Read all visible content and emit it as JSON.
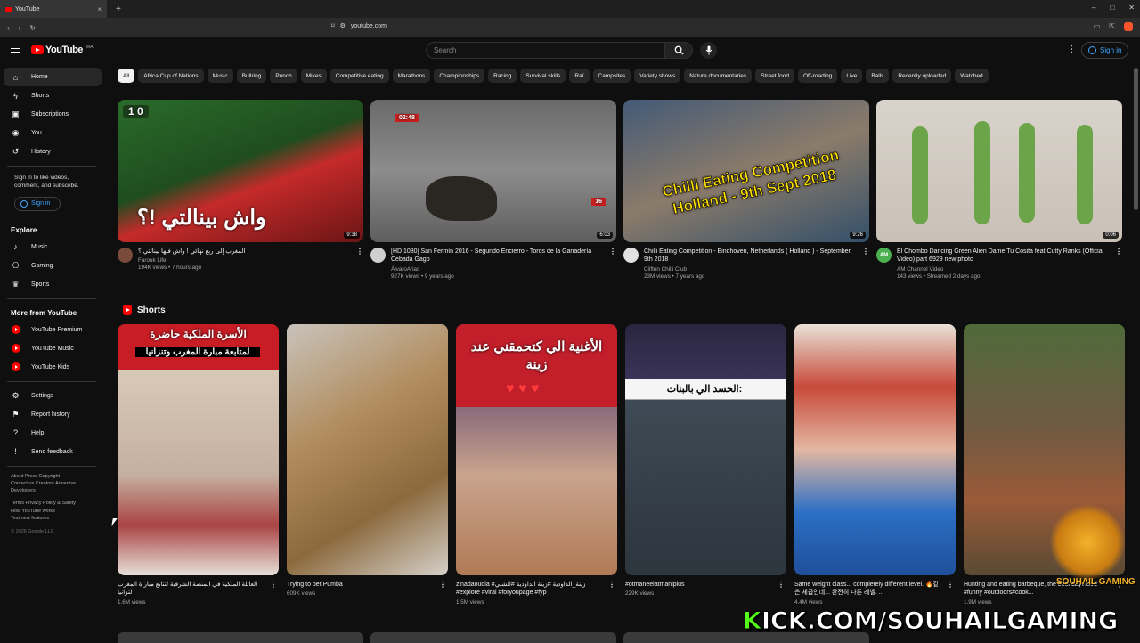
{
  "browser": {
    "tab_title": "YouTube",
    "tab_close": "×",
    "new_tab": "+",
    "url": "youtube.com",
    "min": "–",
    "max": "□",
    "close": "✕"
  },
  "masthead": {
    "logo_text": "YouTube",
    "logo_country": "MA",
    "search_placeholder": "Search",
    "sign_in": "Sign in",
    "more": "⋮"
  },
  "sidebar": {
    "main_items": [
      {
        "label": "Home",
        "icon": "home-icon",
        "glyph": "⌂",
        "active": true
      },
      {
        "label": "Shorts",
        "icon": "shorts-icon",
        "glyph": "ϟ"
      },
      {
        "label": "Subscriptions",
        "icon": "subscriptions-icon",
        "glyph": "▣"
      },
      {
        "label": "You",
        "icon": "user-icon",
        "glyph": "◉"
      },
      {
        "label": "History",
        "icon": "history-icon",
        "glyph": "↺"
      }
    ],
    "signin_text": "Sign in to like videos, comment, and subscribe.",
    "signin_button": "Sign in",
    "explore_heading": "Explore",
    "explore_items": [
      {
        "label": "Music",
        "icon": "music-icon",
        "glyph": "♪"
      },
      {
        "label": "Gaming",
        "icon": "gaming-icon",
        "glyph": "⎔"
      },
      {
        "label": "Sports",
        "icon": "trophy-icon",
        "glyph": "♛"
      }
    ],
    "more_heading": "More from YouTube",
    "more_items": [
      {
        "label": "YouTube Premium",
        "icon": "youtube-premium-icon"
      },
      {
        "label": "YouTube Music",
        "icon": "youtube-music-icon"
      },
      {
        "label": "YouTube Kids",
        "icon": "youtube-kids-icon"
      }
    ],
    "settings_items": [
      {
        "label": "Settings",
        "icon": "gear-icon",
        "glyph": "⚙"
      },
      {
        "label": "Report history",
        "icon": "flag-icon",
        "glyph": "⚑"
      },
      {
        "label": "Help",
        "icon": "help-icon",
        "glyph": "?"
      },
      {
        "label": "Send feedback",
        "icon": "feedback-icon",
        "glyph": "!"
      }
    ],
    "footer_line1": "About  Press  Copyright",
    "footer_line2": "Contact us  Creators  Advertise",
    "footer_line3": "Developers",
    "footer_line4": "Terms  Privacy  Policy & Safety",
    "footer_line5": "How YouTube works",
    "footer_line6": "Test new features",
    "copyright": "© 2026 Google LLC"
  },
  "chips": [
    "All",
    "Africa Cup of Nations",
    "Music",
    "Bullring",
    "Punch",
    "Mixes",
    "Competitive eating",
    "Marathons",
    "Championships",
    "Racing",
    "Survival skills",
    "Raï",
    "Campsites",
    "Variety shows",
    "Nature documentaries",
    "Street food",
    "Off-roading",
    "Live",
    "Balls",
    "Recently uploaded",
    "Watched"
  ],
  "videos": [
    {
      "title": "المغرب إلى ربع نهائي ! واش فيها بينالتي ؟",
      "channel": "Farouk Life",
      "stats": "194K views • 7 hours ago",
      "duration": "9:38",
      "overlay": "واش بينالتي !؟",
      "score": "1  0",
      "avatar_color": "#7a4a3a"
    },
    {
      "title": "[HD 1080] San Fermín 2016 - Segundo Encierro - Toros de la Ganadería Cebada Gago",
      "channel": "ÁlvaroArias",
      "stats": "927K views • 9 years ago",
      "duration": "6:03",
      "overlay": "02:48",
      "score": "16",
      "avatar_color": "#cfcfcf"
    },
    {
      "title": "Chilli Eating Competition - Eindhoven, Netherlands ( Holland ) - September 9th 2018",
      "channel": "Clifton Chilli Club",
      "stats": "23M views • 7 years ago",
      "duration": "9:26",
      "overlay": "Chilli Eating Competition Holland - 9th Sept 2018",
      "score": "",
      "avatar_color": "#e0e0e0"
    },
    {
      "title": "El Chombo Dancing Green Alien Dame Tu Cosita feat Cutty Ranks (Official Video) part 6929 new photo",
      "channel": "AM Channel Video",
      "stats": "143 views • Streamed 2 days ago",
      "duration": "0:06",
      "overlay": "",
      "score": "",
      "avatar_color": "#4caf50",
      "avatar_text": "AM"
    }
  ],
  "shorts_heading": "Shorts",
  "shorts": [
    {
      "title": "العائلة الملكية في المنصة الشرفية لتتابع مباراة المغرب لتزانيا",
      "views": "1.6M views",
      "overlay_top": "الأسرة الملكية حاضرة",
      "overlay_sub": "لمتابعة مبارة المغرب وتنزانيا"
    },
    {
      "title": "Trying to pet Pumba",
      "views": "609K views",
      "overlay_top": "",
      "overlay_sub": ""
    },
    {
      "title": "zinadaoudia #زينة_الداودية #زينة الداودية #الشبي #explore #viral #foryoupage #fyp",
      "views": "1.5M views",
      "overlay_top": "الأغنية الي كتحمقني عند زينة",
      "overlay_sub": ""
    },
    {
      "title": "#otmaneelatmaniplus",
      "views": "229K views",
      "overlay_top": "الحسد الي بالبنات:",
      "overlay_sub": ""
    },
    {
      "title": "Same weight class... completely different level. 🔥같은 체급인데... 완전히 다른 레벨. ...",
      "views": "4.4M views",
      "overlay_top": "",
      "overlay_sub": ""
    },
    {
      "title": "Hunting and eating barbeque, the best day#food #funny #outdoors#cook...",
      "views": "1.9M views",
      "overlay_top": "",
      "overlay_sub": ""
    }
  ],
  "kick": {
    "prefix": "K",
    "rest": "ICK.COM/SOUHAILGAMING"
  },
  "watermark_text": "SOUHAIL GAMING"
}
